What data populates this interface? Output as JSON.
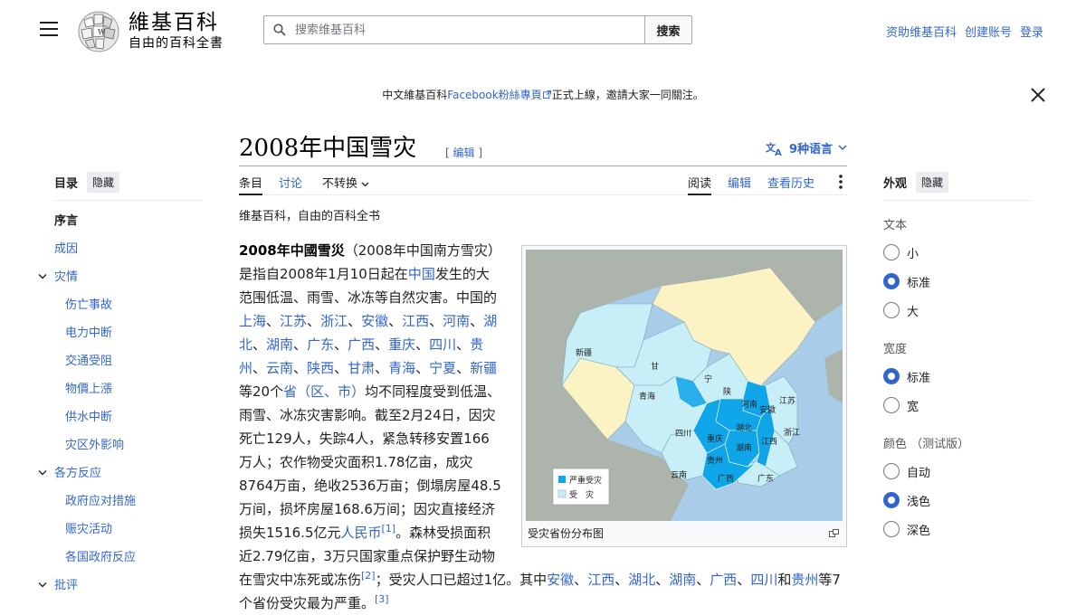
{
  "header": {
    "logo_word": "維基百科",
    "logo_tagline": "自由的百科全書",
    "search_placeholder": "搜索维基百科",
    "search_button": "搜索",
    "user_links": [
      "资助维基百科",
      "创建账号",
      "登录"
    ]
  },
  "banner": {
    "text_before": "中文維基百科",
    "link": "Facebook粉絲專頁",
    "text_after": "正式上線，邀請大家一同關注。"
  },
  "article": {
    "title": "2008年中国雪灾",
    "edit_label": "[ 编辑 ]",
    "languages_label": "9种语言",
    "tabs_left": [
      "条目",
      "讨论",
      "不转换"
    ],
    "tabs_right": [
      "阅读",
      "编辑",
      "查看历史"
    ],
    "site_sub": "维基百科，自由的百科全书",
    "image_caption": "受灾省份分布图"
  },
  "body": {
    "bold_title": "2008年中國雪災",
    "t1": "（2008年中国南方雪灾）是指自2008年1月10日起在",
    "l_china": "中国",
    "t2": "发生的大范围低温、雨雪、冰冻等自然灾害。中国的",
    "provinces": [
      "上海",
      "江苏",
      "浙江",
      "安徽",
      "江西",
      "河南",
      "湖北",
      "湖南",
      "广东",
      "广西",
      "重庆",
      "四川",
      "贵州",
      "云南",
      "陕西",
      "甘肃",
      "青海",
      "宁夏",
      "新疆"
    ],
    "t3": "等20个",
    "l_sheng": "省（区、市）",
    "t4": "均不同程度受到低温、雨雪、冰冻灾害影响。截至2月24日，因灾死亡129人，失踪4人，紧急转移安置166万人；农作物受灾面积1.78亿亩，成灾8764万亩，绝收2536万亩；倒塌房屋48.5万间，损坏房屋168.6万间；因灾直接经济损失1516.5亿元",
    "l_rmb": "人民币",
    "ref1": "[1]",
    "t5": "。森林受损面积近2.79亿亩，3万只国家重点保护野生动物在雪灾中冻死或冻伤",
    "ref2": "[2]",
    "t6": "；受灾人口已超过1亿。其中",
    "provinces2": [
      "安徽",
      "江西",
      "湖北",
      "湖南",
      "广西",
      "四川"
    ],
    "t7": "和",
    "l_guizhou": "贵州",
    "t8": "等7个省份受灾最为严重。",
    "ref3": "[3]"
  },
  "map": {
    "labels": [
      "新疆",
      "甘",
      "宁",
      "陕",
      "青海",
      "四川",
      "重庆",
      "贵州",
      "云南",
      "广西",
      "广东",
      "湖南",
      "湖北",
      "江西",
      "安徽",
      "河南",
      "江苏",
      "浙江"
    ],
    "legend": [
      "严重受灾",
      "受　灾"
    ],
    "colors": {
      "severe": "#0ea5e9",
      "affected": "#c8eef7",
      "other": "#fbf3c4",
      "sea": "#a9cce8",
      "land_outside": "#adb4ab"
    }
  },
  "toc": {
    "title": "目录",
    "hide": "隐藏",
    "items": [
      {
        "label": "序言",
        "level": 0
      },
      {
        "label": "成因",
        "level": 0
      },
      {
        "label": "灾情",
        "level": 0
      },
      {
        "label": "伤亡事故",
        "level": 1
      },
      {
        "label": "电力中断",
        "level": 1
      },
      {
        "label": "交通受阻",
        "level": 1
      },
      {
        "label": "物價上漲",
        "level": 1
      },
      {
        "label": "供水中断",
        "level": 1
      },
      {
        "label": "灾区外影响",
        "level": 1
      },
      {
        "label": "各方反应",
        "level": 0
      },
      {
        "label": "政府应对措施",
        "level": 1
      },
      {
        "label": "赈灾活动",
        "level": 1
      },
      {
        "label": "各国政府反应",
        "level": 1
      },
      {
        "label": "批评",
        "level": 0
      }
    ]
  },
  "appearance": {
    "title": "外观",
    "hide": "隐藏",
    "text_label": "文本",
    "text_options": [
      "小",
      "标准",
      "大"
    ],
    "text_selected": 1,
    "width_label": "宽度",
    "width_options": [
      "标准",
      "宽"
    ],
    "width_selected": 0,
    "color_label": "颜色 （测试版）",
    "color_options": [
      "自动",
      "浅色",
      "深色"
    ],
    "color_selected": 1
  },
  "accent_color": "#3366cc"
}
